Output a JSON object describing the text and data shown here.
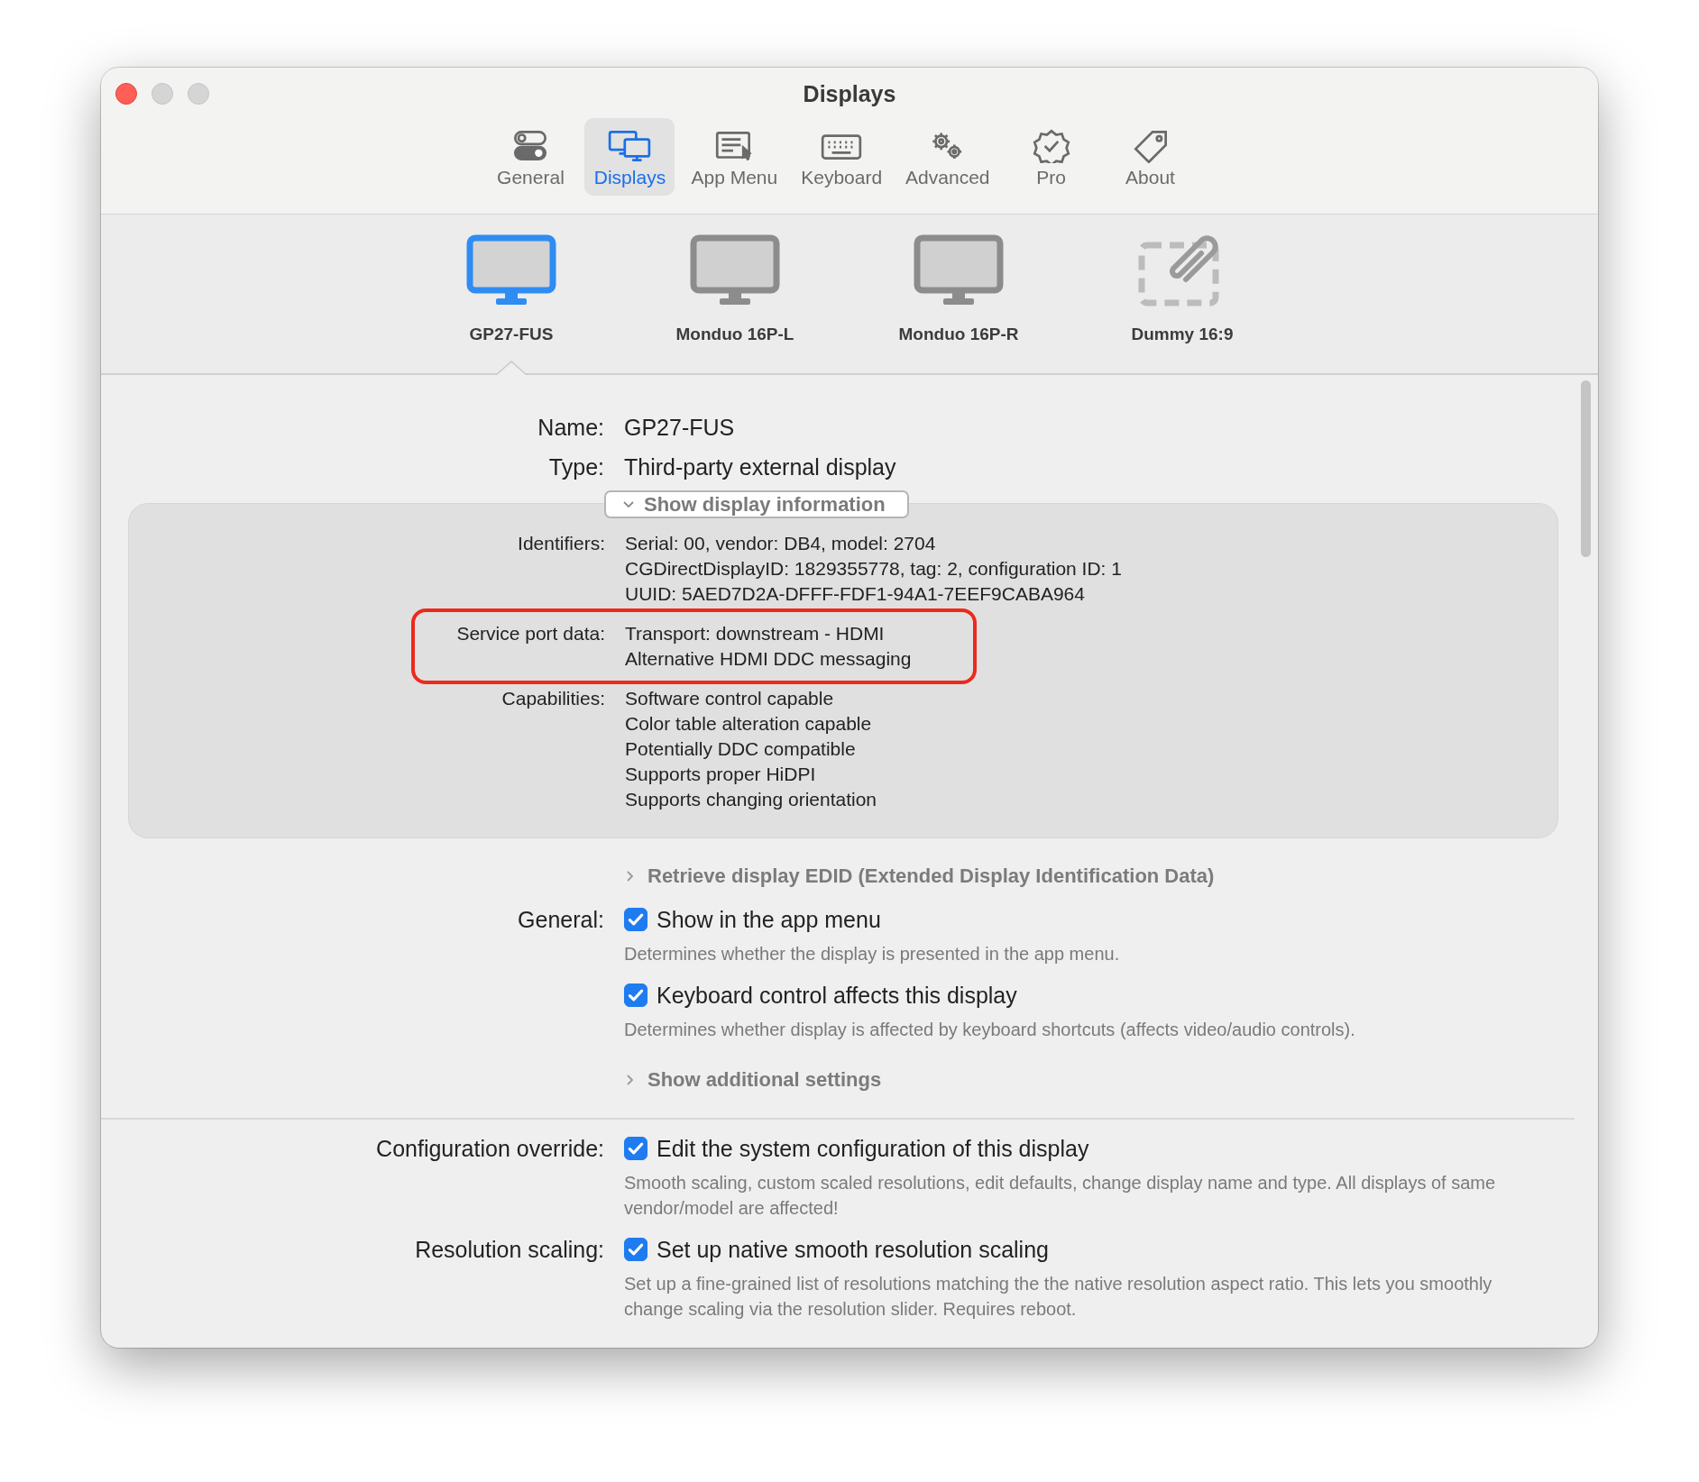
{
  "window": {
    "title": "Displays"
  },
  "tabs": [
    {
      "label": "General",
      "selected": false
    },
    {
      "label": "Displays",
      "selected": true
    },
    {
      "label": "App Menu",
      "selected": false
    },
    {
      "label": "Keyboard",
      "selected": false
    },
    {
      "label": "Advanced",
      "selected": false
    },
    {
      "label": "Pro",
      "selected": false
    },
    {
      "label": "About",
      "selected": false
    }
  ],
  "displays": [
    {
      "name": "GP27-FUS",
      "kind": "monitor",
      "selected": true
    },
    {
      "name": "Monduo 16P-L",
      "kind": "monitor",
      "selected": false
    },
    {
      "name": "Monduo 16P-R",
      "kind": "monitor",
      "selected": false
    },
    {
      "name": "Dummy 16:9",
      "kind": "dummy",
      "selected": false
    }
  ],
  "details": [
    {
      "label": "Name:",
      "value": "GP27-FUS"
    },
    {
      "label": "Type:",
      "value": "Third-party external display"
    }
  ],
  "info_toggle": {
    "label": "Show display information",
    "expanded": true
  },
  "info_rows": [
    {
      "label": "Identifiers:",
      "highlighted": false,
      "lines": [
        "Serial: 00, vendor: DB4, model: 2704",
        "CGDirectDisplayID: 1829355778, tag: 2, configuration ID: 1",
        "UUID: 5AED7D2A-DFFF-FDF1-94A1-7EEF9CABA964"
      ]
    },
    {
      "label": "Service port data:",
      "highlighted": true,
      "lines": [
        "Transport: downstream - HDMI",
        "Alternative HDMI DDC messaging"
      ]
    },
    {
      "label": "Capabilities:",
      "highlighted": false,
      "lines": [
        "Software control capable",
        "Color table alteration capable",
        "Potentially DDC compatible",
        "Supports proper HiDPI",
        "Supports changing orientation"
      ]
    }
  ],
  "sections": [
    [
      {
        "kind": "disclosure",
        "label": "Retrieve display EDID (Extended Display Identification Data)",
        "expanded": false
      },
      {
        "kind": "checkbox",
        "group": "General:",
        "label": "Show in the app menu",
        "checked": true,
        "description": "Determines whether the display is presented in the app menu."
      },
      {
        "kind": "checkbox",
        "label": "Keyboard control affects this display",
        "checked": true,
        "description": "Determines whether display is affected by keyboard shortcuts (affects video/audio controls)."
      },
      {
        "kind": "disclosure",
        "label": "Show additional settings",
        "expanded": false
      }
    ],
    [
      {
        "kind": "checkbox",
        "group": "Configuration override:",
        "label": "Edit the system configuration of this display",
        "checked": true,
        "description": "Smooth scaling, custom scaled resolutions, edit defaults, change display name and type. All displays of same vendor/model are affected!"
      },
      {
        "kind": "checkbox",
        "group": "Resolution scaling:",
        "label": "Set up native smooth resolution scaling",
        "checked": true,
        "description": "Set up a fine-grained list of resolutions matching the the native resolution aspect ratio. This lets you smoothly change scaling via the resolution slider. Requires reboot."
      }
    ]
  ]
}
